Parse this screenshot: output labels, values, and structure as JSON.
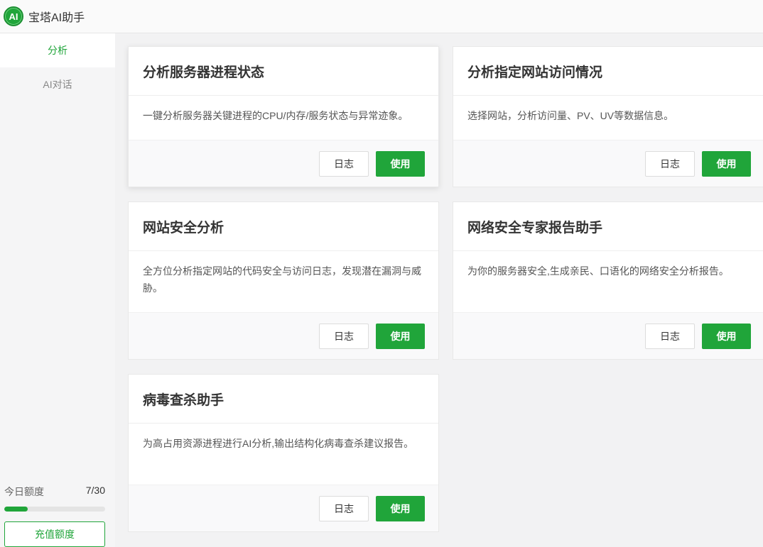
{
  "app": {
    "logo_text": "AI",
    "title": "宝塔AI助手"
  },
  "sidebar": {
    "items": [
      {
        "label": "分析",
        "active": true
      },
      {
        "label": "AI对话",
        "active": false
      }
    ],
    "quota": {
      "label": "今日额度",
      "value": "7/30",
      "used": 7,
      "total": 30
    },
    "recharge_label": "充值额度"
  },
  "buttons": {
    "log": "日志",
    "use": "使用"
  },
  "cards": [
    {
      "title": "分析服务器进程状态",
      "desc": "一键分析服务器关键进程的CPU/内存/服务状态与异常迹象。"
    },
    {
      "title": "分析指定网站访问情况",
      "desc": "选择网站，分析访问量、PV、UV等数据信息。"
    },
    {
      "title": "网站安全分析",
      "desc": "全方位分析指定网站的代码安全与访问日志，发现潜在漏洞与威胁。"
    },
    {
      "title": "网络安全专家报告助手",
      "desc": "为你的服务器安全,生成亲民、口语化的网络安全分析报告。"
    },
    {
      "title": "病毒查杀助手",
      "desc": "为高占用资源进程进行AI分析,输出结构化病毒查杀建议报告。"
    }
  ],
  "colors": {
    "accent": "#20a53a"
  }
}
